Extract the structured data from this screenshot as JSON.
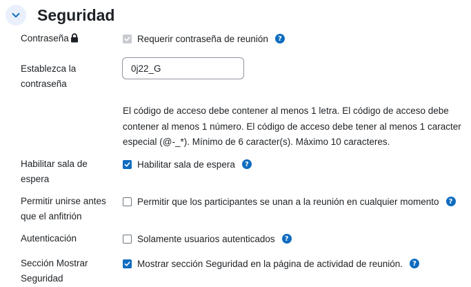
{
  "section": {
    "title": "Seguridad"
  },
  "password": {
    "label": "Contraseña",
    "require_label": "Requerir contraseña de reunión",
    "require_checked": true,
    "require_disabled": true
  },
  "set_password": {
    "label_line1": "Establezca la",
    "label_line2": "contraseña",
    "value": "0j22_G"
  },
  "password_rules": {
    "line1": "El código de acceso debe contener al menos 1 letra. El código de acceso debe",
    "line2": "contener al menos 1 número. El código de acceso debe tener al menos 1 caracter",
    "line3": "especial (@-_*). Mínimo de 6 caracter(s). Máximo 10 caracteres."
  },
  "waiting_room": {
    "label_line1": "Habilitar sala de",
    "label_line2": "espera",
    "checkbox_label": "Habilitar sala de espera",
    "checked": true
  },
  "join_before_host": {
    "label_line1": "Permitir unirse antes",
    "label_line2": "que el anfitrión",
    "checkbox_label": "Permitir que los participantes se unan a la reunión en cualquier momento",
    "checked": false
  },
  "authentication": {
    "label": "Autenticación",
    "checkbox_label": "Solamente usuarios autenticados",
    "checked": false
  },
  "show_security": {
    "label_line1": "Sección Mostrar",
    "label_line2": "Seguridad",
    "checkbox_label": "Mostrar sección Seguridad en la página de actividad de reunión.",
    "checked": true
  },
  "colors": {
    "accent": "#0f6cbf",
    "toggle_bg": "#e9f0fb",
    "disabled": "#c7cbcf"
  },
  "icons": {
    "collapse": "chevron-down-icon",
    "lock": "lock-icon",
    "help": "question-circle-icon",
    "check": "check-icon"
  }
}
